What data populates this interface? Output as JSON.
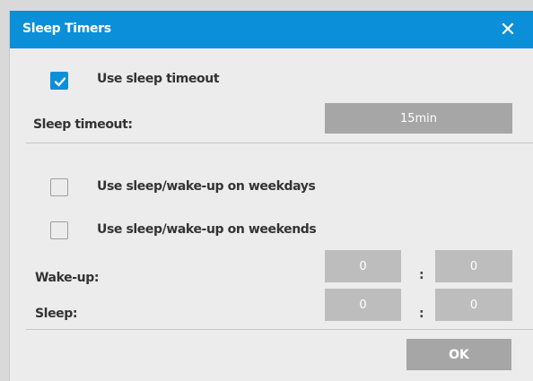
{
  "window": {
    "title": "Sleep Timers"
  },
  "sleep_timeout": {
    "use_label": "Use sleep timeout",
    "use_checked": true,
    "label": "Sleep timeout:",
    "value": "15min"
  },
  "schedule": {
    "weekdays_label": "Use sleep/wake-up on weekdays",
    "weekdays_checked": false,
    "weekends_label": "Use sleep/wake-up on weekends",
    "weekends_checked": false,
    "wakeup_label": "Wake-up:",
    "wakeup_hour": "0",
    "wakeup_minute": "0",
    "sleep_label": "Sleep:",
    "sleep_hour": "0",
    "sleep_minute": "0",
    "separator": ":"
  },
  "buttons": {
    "ok_label": "OK",
    "close_glyph": "✕"
  },
  "colors": {
    "accent": "#0b8fd8",
    "dialog_bg": "#ececec",
    "field_disabled": "#bdbdbd",
    "button_gray": "#a6a6a6"
  }
}
